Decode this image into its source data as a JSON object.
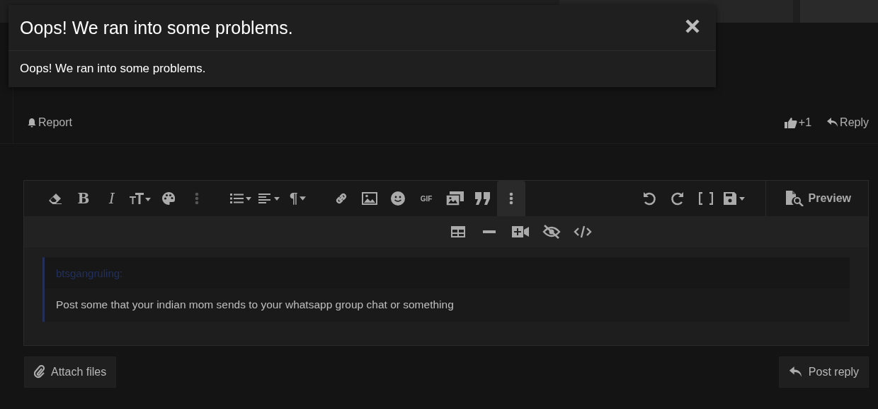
{
  "modal": {
    "title": "Oops! We ran into some problems.",
    "message": "Oops! We ran into some problems."
  },
  "post_actions": {
    "report": "Report",
    "like": "+1",
    "reply": "Reply"
  },
  "editor": {
    "glyphs": {
      "bold": "B",
      "italic": "I",
      "paragraph": "¶",
      "gif": "GIF"
    },
    "more_selected": true,
    "preview": "Preview",
    "quote": {
      "author": "btsgangruling:",
      "text": "Post some that your indian mom sends to your whatsapp group chat or something"
    }
  },
  "buttons": {
    "attach": "Attach files",
    "post": "Post reply"
  }
}
